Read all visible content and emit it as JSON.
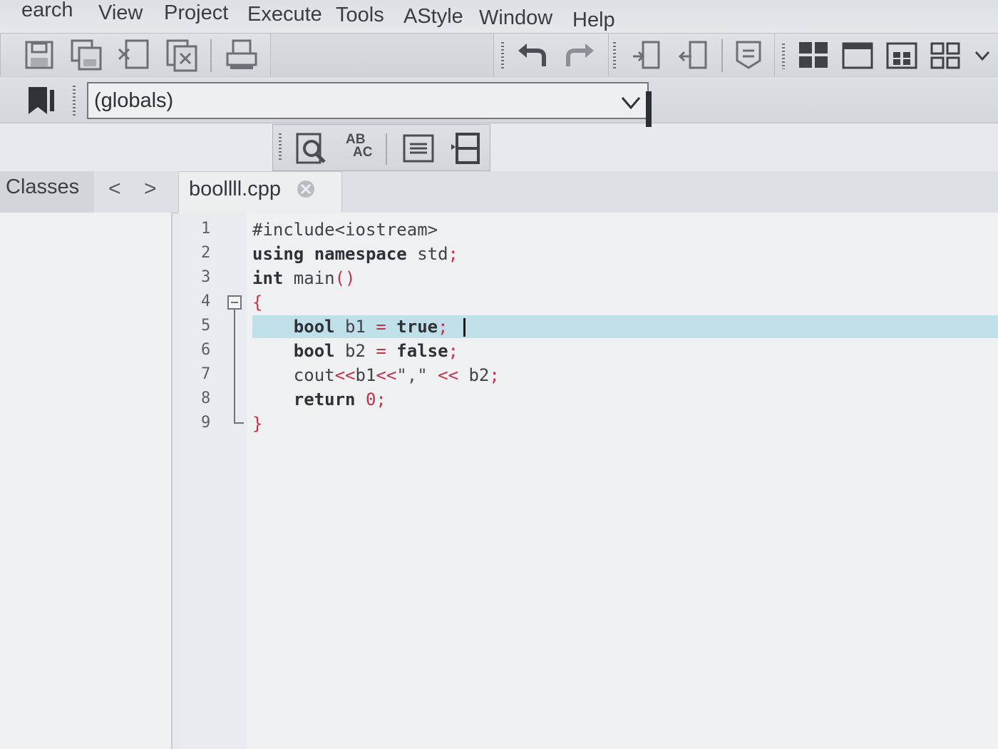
{
  "menu": {
    "items": [
      "earch",
      "View",
      "Project",
      "Execute",
      "Tools",
      "AStyle",
      "Window",
      "Help"
    ]
  },
  "toolbar": {
    "icons": [
      "save-icon",
      "save-all-icon",
      "close-file-icon",
      "close-all-icon",
      "print-icon",
      "undo-icon",
      "redo-icon",
      "indent-icon",
      "unindent-icon",
      "toggle-comment-icon",
      "layout-grid-icon",
      "window-icon",
      "tiles-icon",
      "multi-window-icon",
      "bookmark-icon",
      "find-icon",
      "replace-icon",
      "goto-line-icon",
      "split-icon"
    ]
  },
  "scope_combo": {
    "value": "(globals)"
  },
  "replace_icon_text": {
    "top": "AB",
    "bottom": "AC"
  },
  "left_panel": {
    "tab_label": "Classes",
    "prev": "<",
    "next": ">"
  },
  "editor": {
    "tab_label": "boollll.cpp",
    "line_numbers": [
      "1",
      "2",
      "3",
      "4",
      "5",
      "6",
      "7",
      "8",
      "9"
    ],
    "lines": [
      {
        "parts": [
          {
            "t": "#include<iostream>",
            "c": "plain"
          }
        ]
      },
      {
        "parts": [
          {
            "t": "using namespace",
            "c": "kw"
          },
          {
            "t": " std",
            "c": "plain"
          },
          {
            "t": ";",
            "c": "red"
          }
        ]
      },
      {
        "parts": [
          {
            "t": "int",
            "c": "kw"
          },
          {
            "t": " main",
            "c": "plain"
          },
          {
            "t": "()",
            "c": "red"
          }
        ]
      },
      {
        "parts": [
          {
            "t": "{",
            "c": "red"
          }
        ]
      },
      {
        "parts": [
          {
            "t": "    ",
            "c": "plain"
          },
          {
            "t": "bool",
            "c": "kw"
          },
          {
            "t": " b1 ",
            "c": "plain"
          },
          {
            "t": "=",
            "c": "red"
          },
          {
            "t": " ",
            "c": "plain"
          },
          {
            "t": "true",
            "c": "kw"
          },
          {
            "t": ";",
            "c": "red"
          }
        ]
      },
      {
        "parts": [
          {
            "t": "    ",
            "c": "plain"
          },
          {
            "t": "bool",
            "c": "kw"
          },
          {
            "t": " b2 ",
            "c": "plain"
          },
          {
            "t": "=",
            "c": "red"
          },
          {
            "t": " ",
            "c": "plain"
          },
          {
            "t": "false",
            "c": "kw"
          },
          {
            "t": ";",
            "c": "red"
          }
        ]
      },
      {
        "parts": [
          {
            "t": "    cout",
            "c": "plain"
          },
          {
            "t": "<<",
            "c": "red"
          },
          {
            "t": "b1",
            "c": "plain"
          },
          {
            "t": "<<",
            "c": "red"
          },
          {
            "t": "\",\"",
            "c": "str"
          },
          {
            "t": " ",
            "c": "plain"
          },
          {
            "t": "<<",
            "c": "red"
          },
          {
            "t": " b2",
            "c": "plain"
          },
          {
            "t": ";",
            "c": "red"
          }
        ]
      },
      {
        "parts": [
          {
            "t": "    ",
            "c": "plain"
          },
          {
            "t": "return",
            "c": "kw"
          },
          {
            "t": " ",
            "c": "plain"
          },
          {
            "t": "0",
            "c": "red"
          },
          {
            "t": ";",
            "c": "red"
          }
        ]
      },
      {
        "parts": [
          {
            "t": "}",
            "c": "red"
          }
        ]
      }
    ],
    "active_line_index": 4
  },
  "colors": {
    "keyword": "#2f3136",
    "operator": "#c0344a",
    "active_line": "#bfe0e8"
  }
}
